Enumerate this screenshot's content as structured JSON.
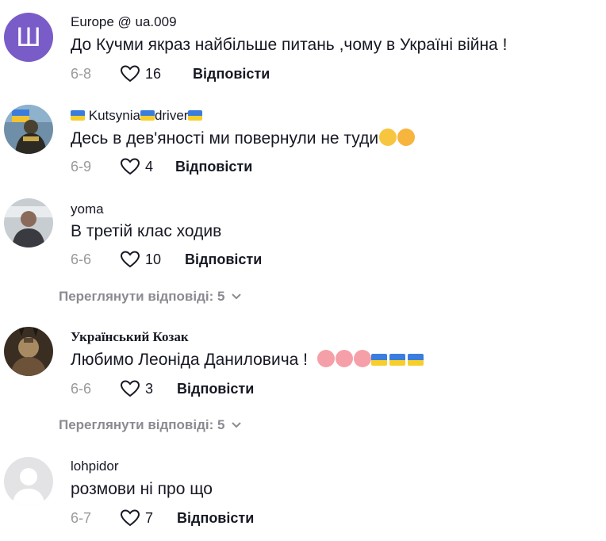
{
  "comments": [
    {
      "avatar_letter": "Ш",
      "username": "Europe @ ua.009",
      "text": "До Кучми якраз найбільше питань ,чому в Україні війна !",
      "date": "6-8",
      "likes": "16",
      "reply": "Відповісти"
    },
    {
      "username_pre": "",
      "username_a": "Kutsynia",
      "username_b": "driver",
      "text": "Десь в дев'яності ми повернули не туди",
      "date": "6-9",
      "likes": "4",
      "reply": "Відповісти"
    },
    {
      "username": "уoma",
      "text": "В третій клас ходив",
      "date": "6-6",
      "likes": "10",
      "reply": "Відповісти"
    },
    {
      "username": "Український Козак",
      "text": "Любимо Леоніда Даниловича !",
      "date": "6-6",
      "likes": "3",
      "reply": "Відповісти"
    },
    {
      "username": "lohpidor",
      "text": "розмови ні про що",
      "date": "6-7",
      "likes": "7",
      "reply": "Відповісти"
    }
  ],
  "view_replies": [
    {
      "label": "Переглянути відповіді: 5"
    },
    {
      "label": "Переглянути відповіді: 5"
    }
  ],
  "colors": {
    "text": "#161823",
    "muted": "#8a8b91",
    "avatar_purple": "#7a5cc8",
    "flag_blue": "#3b7ddd",
    "flag_yellow": "#f6cf2c"
  }
}
